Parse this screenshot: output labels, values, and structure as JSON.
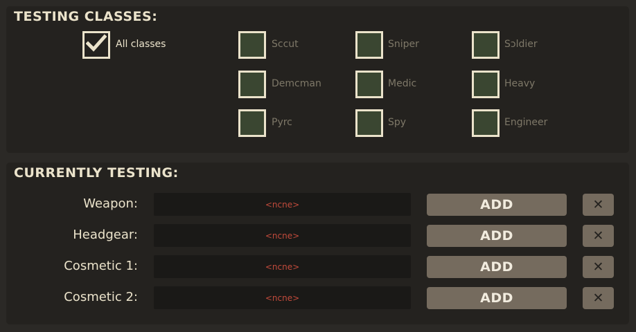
{
  "testing_classes": {
    "title": "TESTING CLASSES:",
    "all_classes": {
      "label": "All classes",
      "checked": true
    },
    "classes": [
      {
        "label": "Sccut",
        "checked": false
      },
      {
        "label": "Sniper",
        "checked": false
      },
      {
        "label": "Sɔldier",
        "checked": false
      },
      {
        "label": "Demcman",
        "checked": false
      },
      {
        "label": "Medic",
        "checked": false
      },
      {
        "label": "Heavy",
        "checked": false
      },
      {
        "label": "Pyrc",
        "checked": false
      },
      {
        "label": "Spy",
        "checked": false
      },
      {
        "label": "Engineer",
        "checked": false
      }
    ]
  },
  "currently_testing": {
    "title": "CURRENTLY TESTING:",
    "slots": [
      {
        "label": "Weapon:",
        "value": "<ncne>",
        "add_label": "ADD",
        "remove_label": "✕"
      },
      {
        "label": "Headgear:",
        "value": "<ncne>",
        "add_label": "ADD",
        "remove_label": "✕"
      },
      {
        "label": "Cosmetic 1:",
        "value": "<ncne>",
        "add_label": "ADD",
        "remove_label": "✕"
      },
      {
        "label": "Cosmetic 2:",
        "value": "<ncne>",
        "add_label": "ADD",
        "remove_label": "✕"
      }
    ]
  },
  "colors": {
    "background": "#2b2926",
    "panel": "#24221f",
    "text": "#ebe3cb",
    "muted_text": "#7e7868",
    "checkbox_fill": "#3a4631",
    "button": "#756b5e",
    "none_text": "#c14a3b"
  },
  "icons": {
    "check": "check-icon",
    "remove": "close-icon"
  }
}
